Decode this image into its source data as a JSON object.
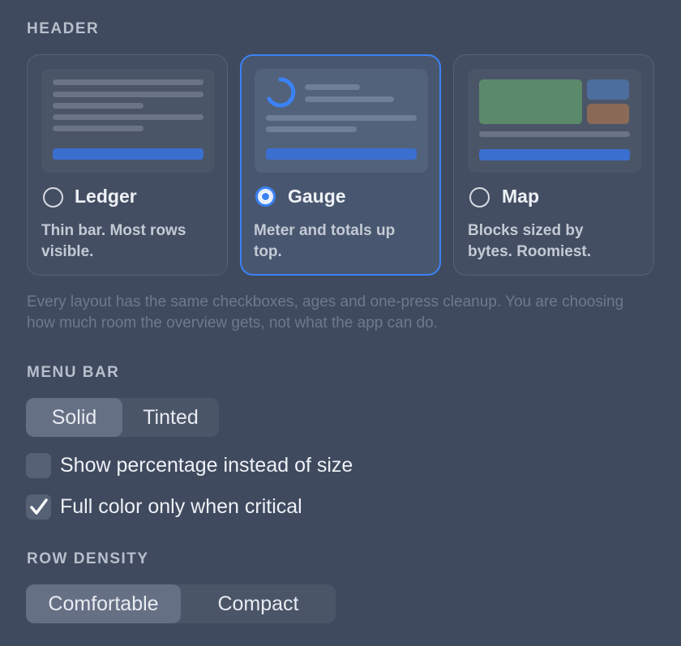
{
  "header": {
    "section_title": "HEADER",
    "cards": [
      {
        "title": "Ledger",
        "desc": "Thin bar. Most rows visible.",
        "selected": false
      },
      {
        "title": "Gauge",
        "desc": "Meter and totals up top.",
        "selected": true
      },
      {
        "title": "Map",
        "desc": "Blocks sized by bytes. Roomiest.",
        "selected": false
      }
    ],
    "note": "Every layout has the same checkboxes, ages and one-press cleanup. You are choosing how much room the overview gets, not what the app can do."
  },
  "menu_bar": {
    "section_title": "MENU BAR",
    "options": [
      "Solid",
      "Tinted"
    ],
    "selected": "Solid",
    "checkboxes": [
      {
        "label": "Show percentage instead of size",
        "checked": false
      },
      {
        "label": "Full color only when critical",
        "checked": true
      }
    ]
  },
  "row_density": {
    "section_title": "ROW DENSITY",
    "options": [
      "Comfortable",
      "Compact"
    ],
    "selected": "Comfortable"
  },
  "colors": {
    "accent": "#3b82f6",
    "background": "#3f4a5e",
    "map_green": "#5b8a6a",
    "map_blue": "#4c6e9e",
    "map_brown": "#8a6a56"
  }
}
